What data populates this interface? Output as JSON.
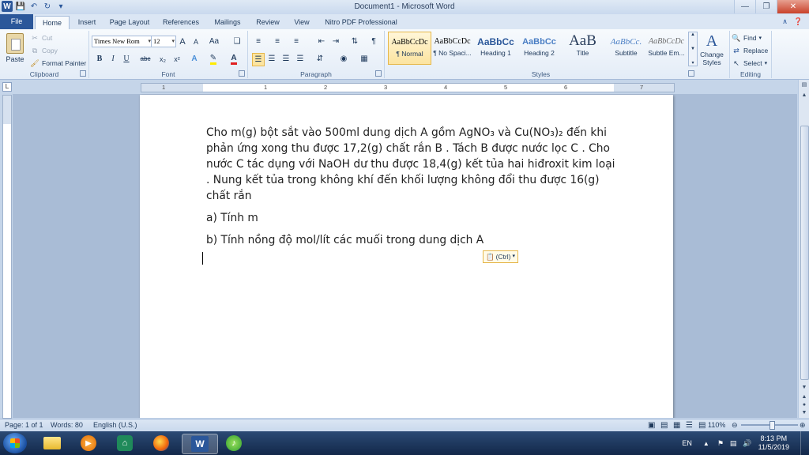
{
  "window": {
    "title": "Document1 - Microsoft Word",
    "qat_icons": [
      "word-icon",
      "save-icon",
      "undo-icon",
      "redo-icon",
      "customize-icon"
    ]
  },
  "tabs": [
    {
      "label": "File",
      "name": "tab-file"
    },
    {
      "label": "Home",
      "name": "tab-home",
      "active": true
    },
    {
      "label": "Insert",
      "name": "tab-insert"
    },
    {
      "label": "Page Layout",
      "name": "tab-page-layout"
    },
    {
      "label": "References",
      "name": "tab-references"
    },
    {
      "label": "Mailings",
      "name": "tab-mailings"
    },
    {
      "label": "Review",
      "name": "tab-review"
    },
    {
      "label": "View",
      "name": "tab-view"
    },
    {
      "label": "Nitro PDF Professional",
      "name": "tab-nitro"
    }
  ],
  "ribbon": {
    "clipboard": {
      "label": "Clipboard",
      "paste": "Paste",
      "cut": "Cut",
      "copy": "Copy",
      "format_painter": "Format Painter"
    },
    "font": {
      "label": "Font",
      "family": "Times New Rom",
      "size": "12",
      "grow": "A",
      "shrink": "A",
      "change_case": "Aa",
      "bold": "B",
      "italic": "I",
      "underline": "U",
      "strike": "abc",
      "subscript": "x₂",
      "superscript": "x²",
      "text_effects": "A",
      "font_color": "A"
    },
    "paragraph": {
      "label": "Paragraph",
      "show_marks": "¶"
    },
    "styles": {
      "label": "Styles",
      "items": [
        {
          "sample": "AaBbCcDc",
          "name": "¶ Normal",
          "current": true
        },
        {
          "sample": "AaBbCcDc",
          "name": "¶ No Spaci..."
        },
        {
          "sample": "AaBbCc",
          "name": "Heading 1"
        },
        {
          "sample": "AaBbCc",
          "name": "Heading 2"
        },
        {
          "sample": "AaB",
          "name": "Title"
        },
        {
          "sample": "AaBbCc.",
          "name": "Subtitle"
        },
        {
          "sample": "AaBbCcDc",
          "name": "Subtle Em..."
        }
      ],
      "change_styles": "Change Styles"
    },
    "editing": {
      "label": "Editing",
      "find": "Find",
      "replace": "Replace",
      "select": "Select"
    }
  },
  "ruler": {
    "h_numbers": [
      "1",
      "1",
      "2",
      "3",
      "4",
      "5",
      "6",
      "7"
    ]
  },
  "document": {
    "paragraphs": [
      "Cho m(g) bột sắt vào 500ml dung dịch A gồm AgNO₃ và Cu(NO₃)₂ đến khi phản ứng xong thu được 17,2(g) chất rắn B . Tách B được nước lọc C . Cho nước C tác dụng với NaOH dư thu được 18,4(g) kết tủa hai hiđroxit kim loại . Nung kết tủa trong không khí đến khối lượng không đổi thu được 16(g) chất rắn",
      "a) Tính m",
      "b) Tính nồng độ mol/lít các muối trong dung dịch A"
    ],
    "paste_options": "(Ctrl)"
  },
  "status": {
    "page": "Page: 1 of 1",
    "words": "Words: 80",
    "language": "English (U.S.)",
    "zoom": "110%",
    "zoom_fraction": 0.55
  },
  "taskbar": {
    "language": "EN",
    "time": "8:13 PM",
    "date": "11/5/2019",
    "apps": [
      "start-button",
      "file-explorer-icon",
      "media-player-icon",
      "app-green-icon",
      "firefox-icon",
      "word-taskbar-icon",
      "app-music-icon"
    ]
  },
  "colors": {
    "accent": "#2b579a",
    "ribbon_bg": "#dbe6f4",
    "selected_style": "#fce4a0"
  }
}
